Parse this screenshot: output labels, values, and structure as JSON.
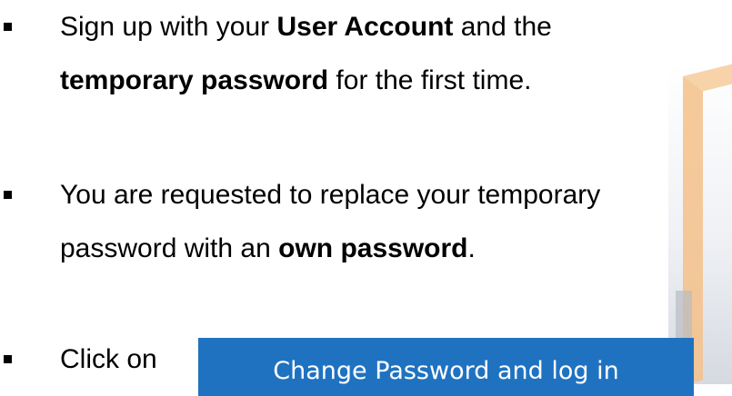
{
  "bullets": [
    {
      "line1_before": "Sign up with your ",
      "line1_bold": "User Account",
      "line1_after": " and the",
      "line2_bold": "temporary password",
      "line2_after": " for the first time."
    },
    {
      "line1": "You are requested to replace your temporary",
      "line2_before": "password with an ",
      "line2_bold": "own password",
      "line2_after": "."
    },
    {
      "text": "Click on"
    }
  ],
  "button": {
    "label": "Change Password and log in"
  },
  "colors": {
    "button_bg": "#1f72c0",
    "button_text": "#ffffff",
    "text": "#000000",
    "bullet_marker": "#000000"
  },
  "icons": {
    "bullet_marker": "square-bullet-icon"
  }
}
